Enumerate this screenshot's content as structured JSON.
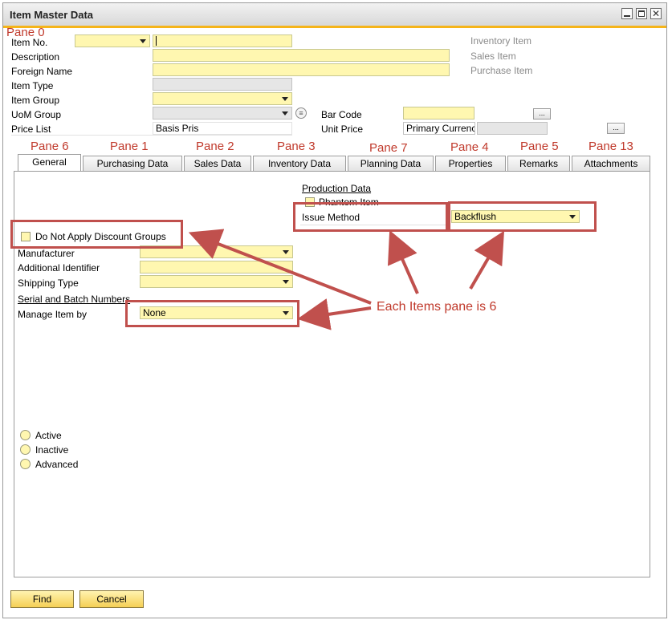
{
  "window": {
    "title": "Item Master Data"
  },
  "header": {
    "pane_label": "Pane 0",
    "item_no_label": "Item No.",
    "description_label": "Description",
    "foreign_name_label": "Foreign Name",
    "item_type_label": "Item Type",
    "item_group_label": "Item Group",
    "uom_group_label": "UoM Group",
    "price_list_label": "Price List",
    "price_list_value": "Basis Pris",
    "bar_code_label": "Bar Code",
    "unit_price_label": "Unit Price",
    "unit_price_currency": "Primary Currenc",
    "inventory_item_label": "Inventory Item",
    "sales_item_label": "Sales Item",
    "purchase_item_label": "Purchase Item",
    "browse_label": "..."
  },
  "tabs": [
    {
      "label": "General",
      "pane": "Pane 6"
    },
    {
      "label": "Purchasing Data",
      "pane": "Pane 1"
    },
    {
      "label": "Sales Data",
      "pane": "Pane 2"
    },
    {
      "label": "Inventory Data",
      "pane": "Pane 3"
    },
    {
      "label": "Planning Data",
      "pane": "Pane 7"
    },
    {
      "label": "Properties",
      "pane": "Pane 4"
    },
    {
      "label": "Remarks",
      "pane": "Pane 5"
    },
    {
      "label": "Attachments",
      "pane": "Pane 13"
    }
  ],
  "general": {
    "production_data_label": "Production Data",
    "phantom_item_label": "Phantom Item",
    "issue_method_label": "Issue Method",
    "issue_method_value": "Backflush",
    "no_discount_label": "Do Not Apply Discount Groups",
    "manufacturer_label": "Manufacturer",
    "additional_identifier_label": "Additional Identifier",
    "shipping_type_label": "Shipping Type",
    "serial_batch_label": "Serial and Batch Numbers",
    "manage_item_by_label": "Manage Item by",
    "manage_item_by_value": "None",
    "status_options": [
      "Active",
      "Inactive",
      "Advanced"
    ]
  },
  "annotation": {
    "text": "Each Items pane is 6"
  },
  "footer": {
    "find_label": "Find",
    "cancel_label": "Cancel"
  },
  "colors": {
    "field_yellow": "#fff7b0",
    "accent_orange": "#f5b419",
    "annotation_red": "#c0504d"
  }
}
